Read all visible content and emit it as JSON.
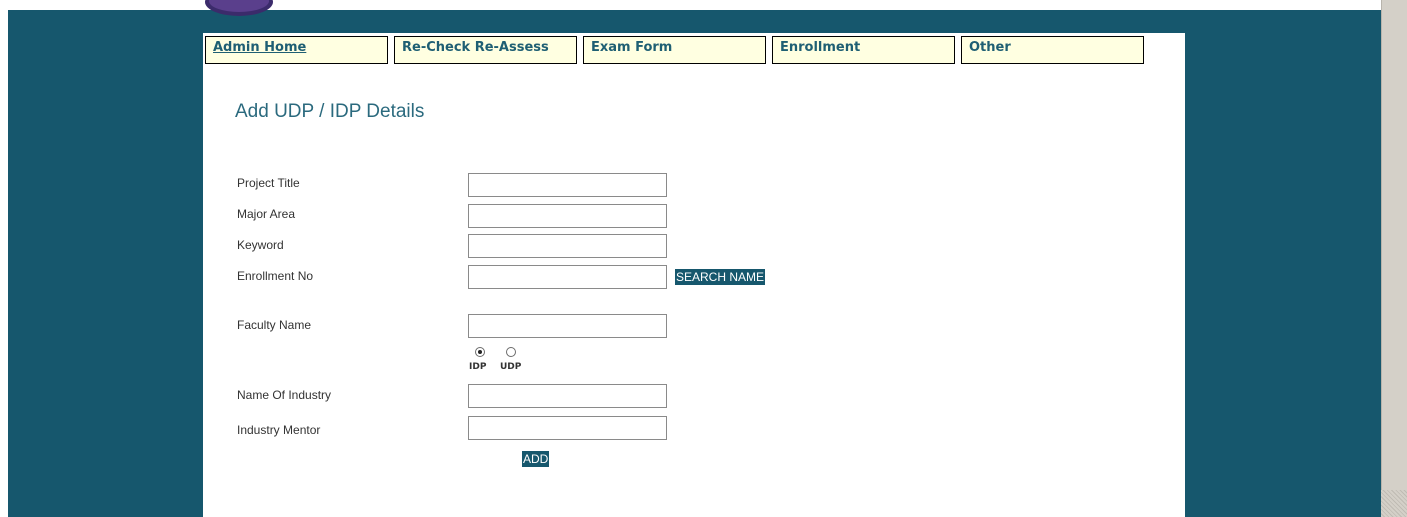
{
  "nav": {
    "tabs": [
      {
        "label": "Admin Home"
      },
      {
        "label": "Re-Check Re-Assess"
      },
      {
        "label": "Exam Form"
      },
      {
        "label": "Enrollment"
      },
      {
        "label": "Other"
      }
    ]
  },
  "form": {
    "title": "Add UDP / IDP Details",
    "fields": [
      {
        "label": "Project Title",
        "value": ""
      },
      {
        "label": "Major Area",
        "value": ""
      },
      {
        "label": "Keyword",
        "value": ""
      },
      {
        "label": "Enrollment No",
        "value": ""
      },
      {
        "label": "Faculty Name",
        "value": ""
      },
      {
        "label": "Name Of Industry",
        "value": ""
      },
      {
        "label": "Industry Mentor",
        "value": ""
      }
    ],
    "search_button": "SEARCH NAME",
    "type_options": [
      {
        "label": "IDP",
        "selected": true
      },
      {
        "label": "UDP",
        "selected": false
      }
    ],
    "add_button": "ADD"
  },
  "colors": {
    "background": "#16576d",
    "tab_bg": "#ffffe1",
    "tab_text": "#1f5f73",
    "title": "#2b6a7e"
  }
}
